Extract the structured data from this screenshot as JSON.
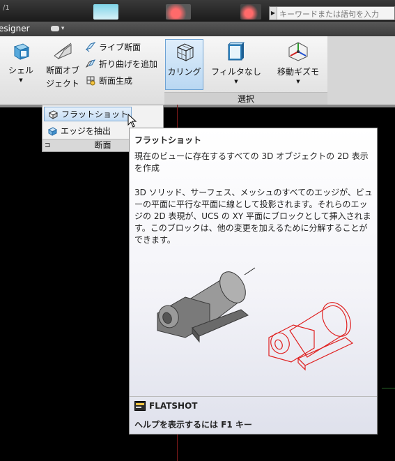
{
  "topbar": {
    "tab_number": "1"
  },
  "search": {
    "placeholder": "キーワードまたは語句を入力"
  },
  "tabrow": {
    "workspace_label": "esigner"
  },
  "ribbon": {
    "shell_label": "シェル",
    "section_plane_label_1": "断面オブ",
    "section_plane_label_2": "ジェクト",
    "live_section_label": "ライブ断面",
    "add_jog_label": "折り曲げを追加",
    "generate_section_label": "断面生成",
    "culling_label": "カリング",
    "filter_label": "フィルタなし",
    "gizmo_label": "移動ギズモ",
    "selection_panel_label": "選択"
  },
  "dropdown": {
    "flatshot_label": "フラットショット",
    "extract_edges_label": "エッジを抽出",
    "panel_label": "断面"
  },
  "tooltip": {
    "title": "フラットショット",
    "description": "現在のビューに存在するすべての 3D オブジェクトの 2D 表示を作成",
    "body": "3D ソリッド、サーフェス、メッシュのすべてのエッジが、ビューの平面に平行な平面に線として投影されます。それらのエッジの 2D 表現が、UCS の XY 平面にブロックとして挿入されます。このブロックは、他の変更を加えるために分解することができます。",
    "command": "FLATSHOT",
    "help": "ヘルプを表示するには F1 キー"
  },
  "colors": {
    "highlight": "#c6def5",
    "illustration_red": "#e02020"
  }
}
